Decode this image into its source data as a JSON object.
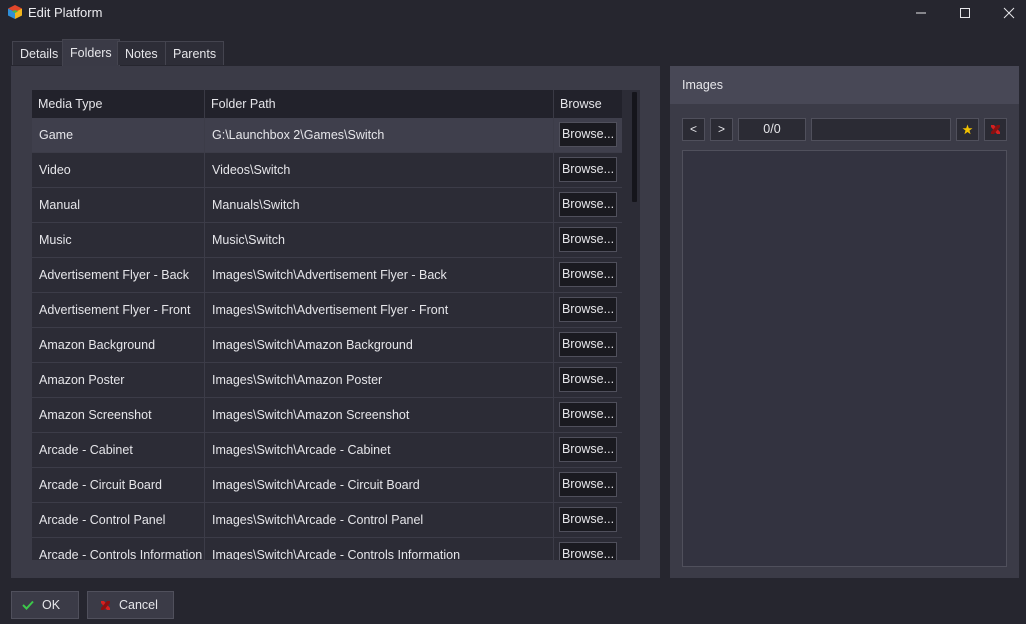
{
  "window": {
    "title": "Edit Platform"
  },
  "tabs": [
    {
      "label": "Details",
      "active": false
    },
    {
      "label": "Folders",
      "active": true
    },
    {
      "label": "Notes",
      "active": false
    },
    {
      "label": "Parents",
      "active": false
    }
  ],
  "grid": {
    "columns": [
      "Media Type",
      "Folder Path",
      "Browse"
    ],
    "browse_label": "Browse...",
    "rows": [
      {
        "media_type": "Game",
        "folder_path": "G:\\Launchbox 2\\Games\\Switch",
        "selected": true
      },
      {
        "media_type": "Video",
        "folder_path": "Videos\\Switch"
      },
      {
        "media_type": "Manual",
        "folder_path": "Manuals\\Switch"
      },
      {
        "media_type": "Music",
        "folder_path": "Music\\Switch"
      },
      {
        "media_type": "Advertisement Flyer - Back",
        "folder_path": "Images\\Switch\\Advertisement Flyer - Back"
      },
      {
        "media_type": "Advertisement Flyer - Front",
        "folder_path": "Images\\Switch\\Advertisement Flyer - Front"
      },
      {
        "media_type": "Amazon Background",
        "folder_path": "Images\\Switch\\Amazon Background"
      },
      {
        "media_type": "Amazon Poster",
        "folder_path": "Images\\Switch\\Amazon Poster"
      },
      {
        "media_type": "Amazon Screenshot",
        "folder_path": "Images\\Switch\\Amazon Screenshot"
      },
      {
        "media_type": "Arcade - Cabinet",
        "folder_path": "Images\\Switch\\Arcade - Cabinet"
      },
      {
        "media_type": "Arcade - Circuit Board",
        "folder_path": "Images\\Switch\\Arcade - Circuit Board"
      },
      {
        "media_type": "Arcade - Control Panel",
        "folder_path": "Images\\Switch\\Arcade - Control Panel"
      },
      {
        "media_type": "Arcade - Controls Information",
        "folder_path": "Images\\Switch\\Arcade - Controls Information"
      }
    ]
  },
  "images_panel": {
    "title": "Images",
    "prev_label": "<",
    "next_label": ">",
    "counter": "0/0",
    "name_value": "",
    "add_icon": "add-star-icon",
    "remove_icon": "remove-icon"
  },
  "footer": {
    "ok_label": "OK",
    "cancel_label": "Cancel"
  },
  "colors": {
    "background": "#26262f",
    "panel": "#3b3b47",
    "grid": "#2c2c36",
    "header": "#22222b",
    "accent_yellow": "#f2c200",
    "accent_red": "#d42020",
    "ok_green": "#3cc84a"
  }
}
